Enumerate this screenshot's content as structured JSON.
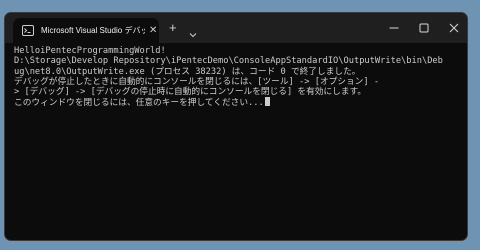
{
  "window": {
    "tab_title": "Microsoft Visual Studio デバッグ",
    "close_tab_glyph": "✕",
    "new_tab_glyph": "+",
    "icons": {
      "tab_icon": "terminal-icon",
      "dropdown": "chevron-down-icon",
      "minimize": "minimize-icon",
      "maximize": "maximize-icon",
      "close": "close-icon"
    }
  },
  "console": {
    "lines": [
      "HelloiPentecProgrammingWorld!",
      "D:\\Storage\\Develop Repository\\iPentecDemo\\ConsoleAppStandardIO\\OutputWrite\\bin\\Deb",
      "ug\\net8.0\\OutputWrite.exe (プロセス 38232) は、コード 0 で終了しました。",
      "デバッグが停止したときに自動的にコンソールを閉じるには、[ツール] -> [オプション] -",
      "> [デバッグ] -> [デバッグの停止時に自動的にコンソールを閉じる] を有効にします。",
      "このウィンドウを閉じるには、任意のキーを押してください..."
    ]
  },
  "colors": {
    "desktop": "#6f94b3",
    "titlebar": "#1f1f1f",
    "console_bg": "#0c0c0c",
    "console_text": "#cccccc"
  }
}
